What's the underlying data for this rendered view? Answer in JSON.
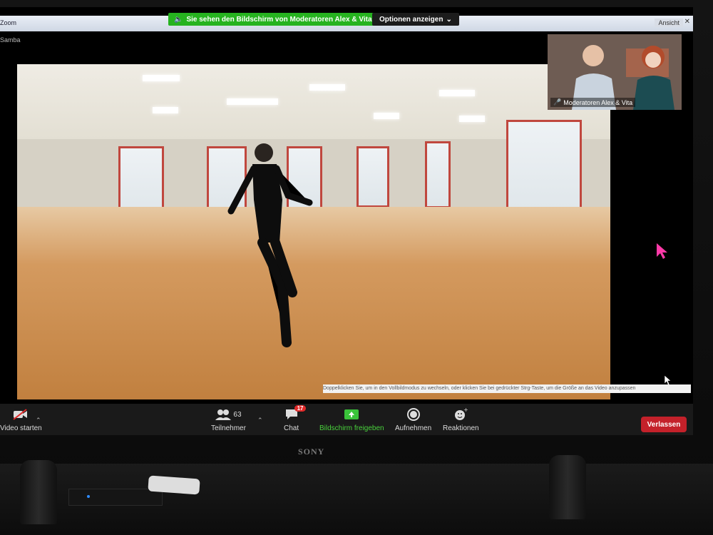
{
  "window": {
    "app_title": "Zoom",
    "ansicht_label": "Ansicht",
    "tab_label": "Samba"
  },
  "share_banner": {
    "text": "Sie sehen den Bildschirm von Moderatoren Alex & Vita",
    "options_label": "Optionen anzeigen"
  },
  "presenter": {
    "name": "Moderatoren Alex & Vita"
  },
  "caption": {
    "text": "Doppelklicken Sie, um in den Vollbildmodus zu wechseln, oder klicken Sie bei gedrückter Strg-Taste, um die Größe an das Video anzupassen"
  },
  "toolbar": {
    "video_label": "Video starten",
    "participants_label": "Teilnehmer",
    "participants_count": "63",
    "chat_label": "Chat",
    "chat_badge": "17",
    "share_label": "Bildschirm freigeben",
    "record_label": "Aufnehmen",
    "reactions_label": "Reaktionen",
    "leave_label": "Verlassen"
  },
  "tv": {
    "brand": "SONY"
  },
  "colors": {
    "share_green": "#26b31f",
    "leave_red": "#c4212a",
    "badge_red": "#e02828",
    "share_label_green": "#49d33c"
  }
}
